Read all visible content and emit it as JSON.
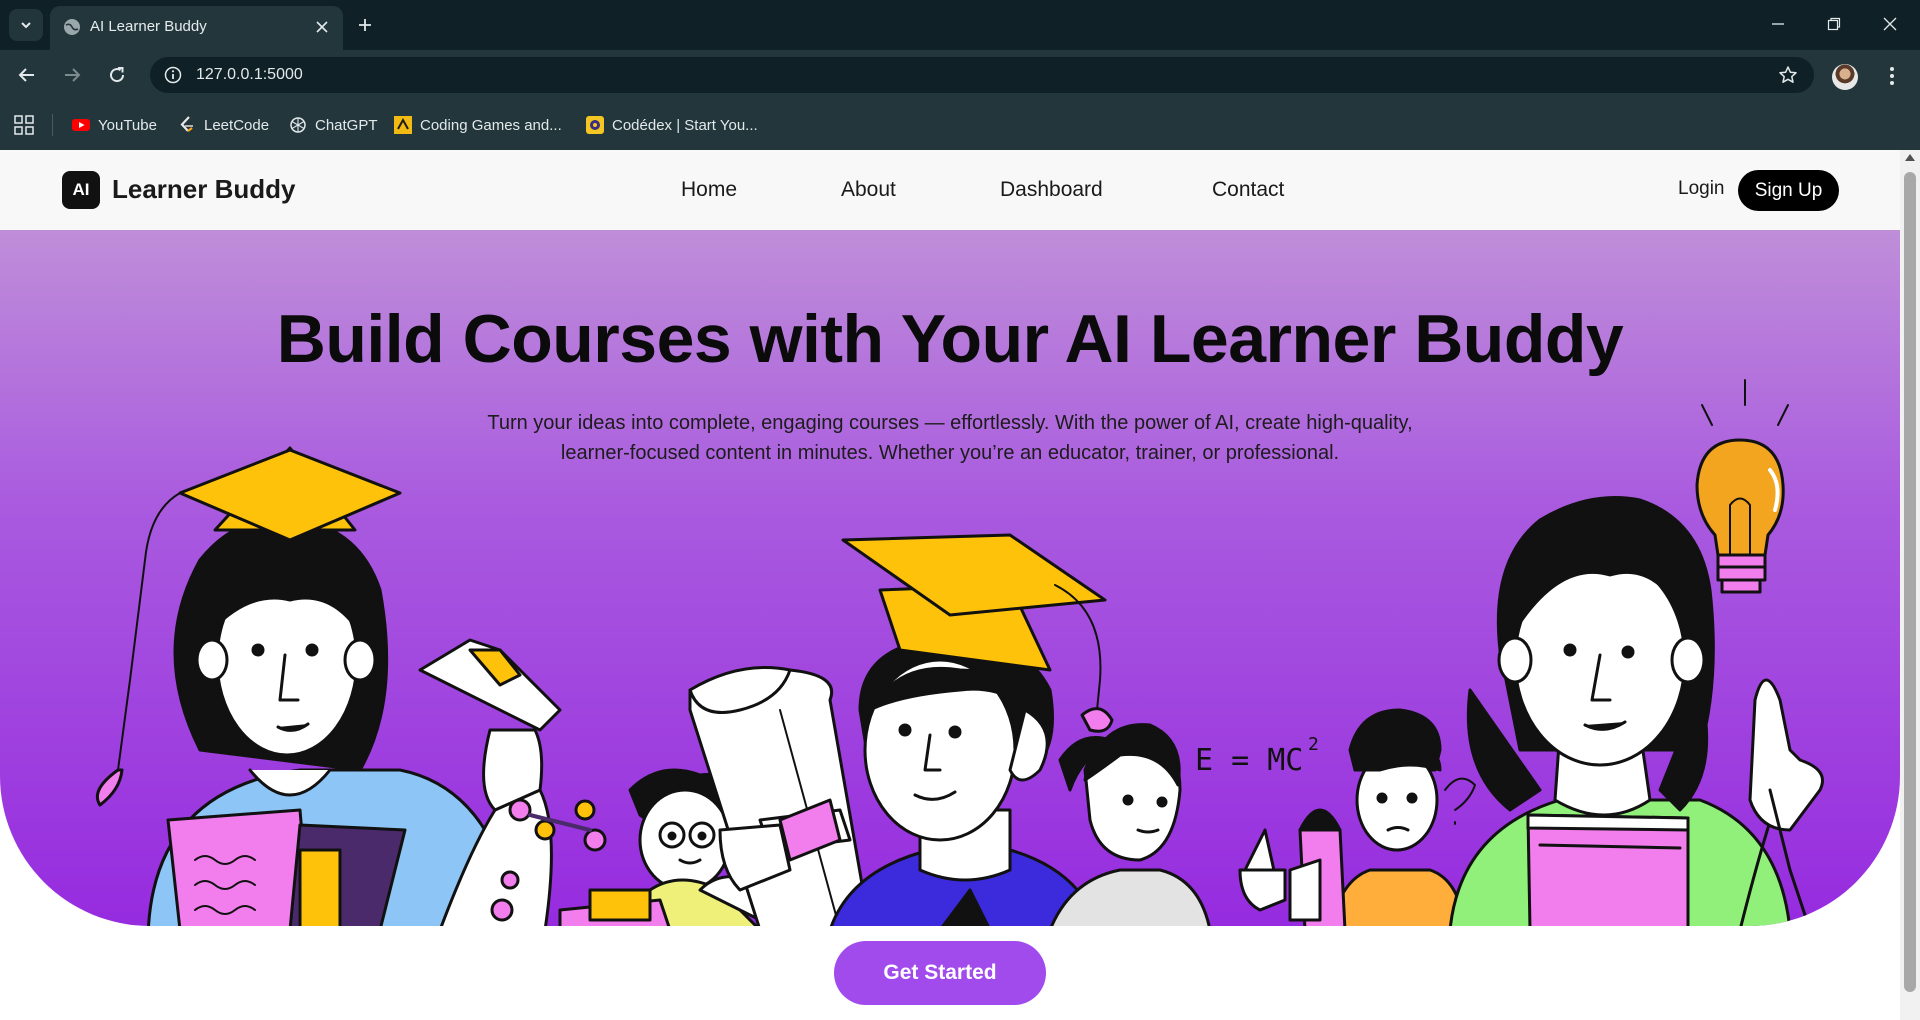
{
  "browser": {
    "tab_title": "AI Learner Buddy",
    "url": "127.0.0.1:5000",
    "icons": [
      "tab-list-icon",
      "globe-icon",
      "close-icon",
      "plus-icon",
      "minimize-icon",
      "restore-icon",
      "close-window-icon",
      "back-icon",
      "forward-icon",
      "reload-icon",
      "info-icon",
      "star-icon",
      "menu-dots-icon",
      "apps-icon"
    ]
  },
  "bookmarks": [
    {
      "label": "YouTube",
      "icon": "youtube-icon"
    },
    {
      "label": "LeetCode",
      "icon": "leetcode-icon"
    },
    {
      "label": "ChatGPT",
      "icon": "chatgpt-icon"
    },
    {
      "label": "Coding Games and...",
      "icon": "codingame-icon"
    },
    {
      "label": "Codédex | Start You...",
      "icon": "codedex-icon"
    }
  ],
  "site": {
    "logo_badge": "AI",
    "logo_text": "Learner Buddy",
    "nav": [
      "Home",
      "About",
      "Dashboard",
      "Contact"
    ],
    "login": "Login",
    "signup": "Sign Up"
  },
  "hero": {
    "title": "Build Courses with Your AI Learner Buddy",
    "subtitle": "Turn your ideas into complete, engaging courses — effortlessly. With the power of AI, create high-quality, learner-focused content in minutes. Whether you’re an educator, trainer, or professional.",
    "illustration_text": "E = MC",
    "illustration_sup": "2",
    "cta": "Get Started"
  },
  "colors": {
    "hero_top": "#bf8ed9",
    "hero_bottom": "#962bdf",
    "cta": "#a14bed",
    "browser_dark": "#0f2126",
    "browser_toolbar": "#22363b"
  }
}
